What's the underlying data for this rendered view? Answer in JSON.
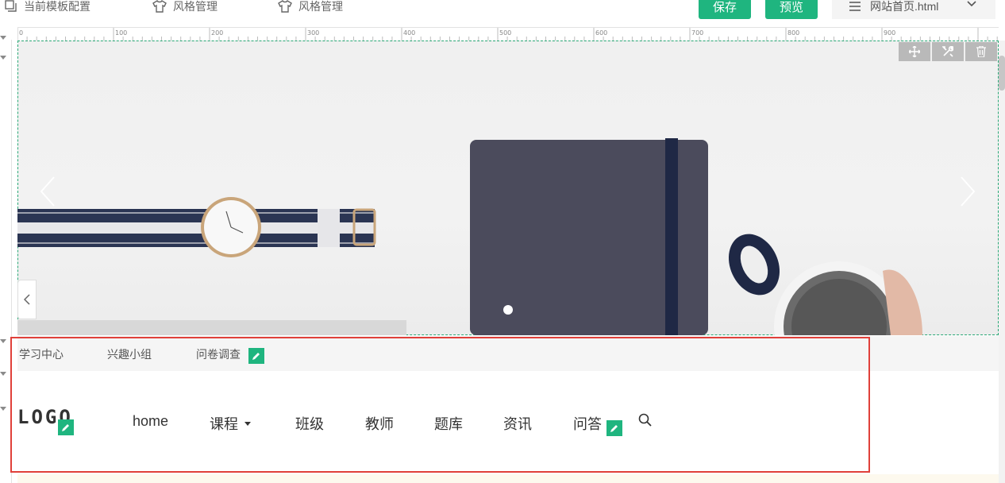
{
  "toolbar": {
    "template_config": "当前模板配置",
    "style_manage_1": "风格管理",
    "style_manage_2": "风格管理",
    "save_label": "保存",
    "preview_label": "预览",
    "current_page": "网站首页.html",
    "accent_color": "#1fb57f"
  },
  "ruler": {
    "ticks": [
      "0",
      "100",
      "200",
      "300",
      "400",
      "500",
      "600",
      "700",
      "800",
      "900"
    ]
  },
  "banner": {
    "image": "desk-flatlay-watch-notebook-coffee",
    "slide_count": 1,
    "tools": [
      "move-icon",
      "settings-icon",
      "trash-icon"
    ]
  },
  "topbar": {
    "links": [
      "学习中心",
      "兴趣小组",
      "问卷调查"
    ]
  },
  "nav": {
    "logo": "LOGO",
    "items": [
      "home",
      "课程",
      "班级",
      "教师",
      "题库",
      "资讯",
      "问答"
    ],
    "search_icon": "search-icon"
  },
  "colors": {
    "selection_border": "#e0403a",
    "edit_badge": "#1fb57f",
    "dashed_outline": "#2aa876"
  }
}
